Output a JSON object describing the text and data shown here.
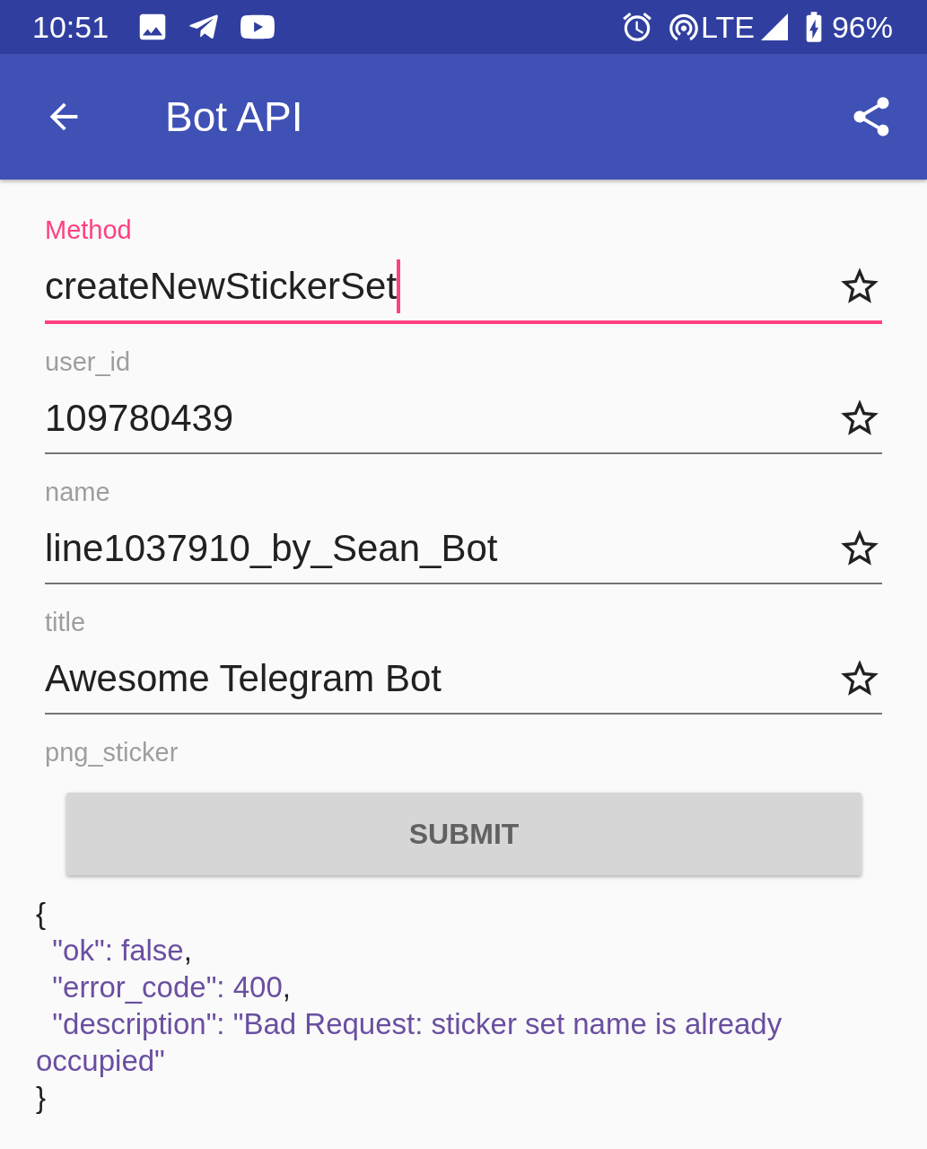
{
  "status_bar": {
    "time": "10:51",
    "network": "LTE",
    "battery": "96%"
  },
  "app_bar": {
    "title": "Bot API"
  },
  "fields": [
    {
      "kind": "text",
      "label": "Method",
      "value": "createNewStickerSet",
      "focused": true,
      "starred": false
    },
    {
      "kind": "text",
      "label": "user_id",
      "value": "109780439",
      "focused": false,
      "starred": false
    },
    {
      "kind": "text",
      "label": "name",
      "value": "line1037910_by_Sean_Bot",
      "focused": false,
      "starred": false
    },
    {
      "kind": "text",
      "label": "title",
      "value": "Awesome Telegram Bot",
      "focused": false,
      "starred": false
    },
    {
      "kind": "file",
      "label": "png_sticker"
    }
  ],
  "submit": {
    "label": "SUBMIT"
  },
  "response": [
    [
      {
        "kind": "punct",
        "text": "{"
      }
    ],
    [
      {
        "kind": "value",
        "text": "  \"ok\": false"
      },
      {
        "kind": "punct",
        "text": ","
      }
    ],
    [
      {
        "kind": "value",
        "text": "  \"error_code\": 400"
      },
      {
        "kind": "punct",
        "text": ","
      }
    ],
    [
      {
        "kind": "value",
        "text": "  \"description\": \"Bad Request: sticker set name is already occupied\""
      }
    ],
    [
      {
        "kind": "punct",
        "text": "}"
      }
    ]
  ]
}
